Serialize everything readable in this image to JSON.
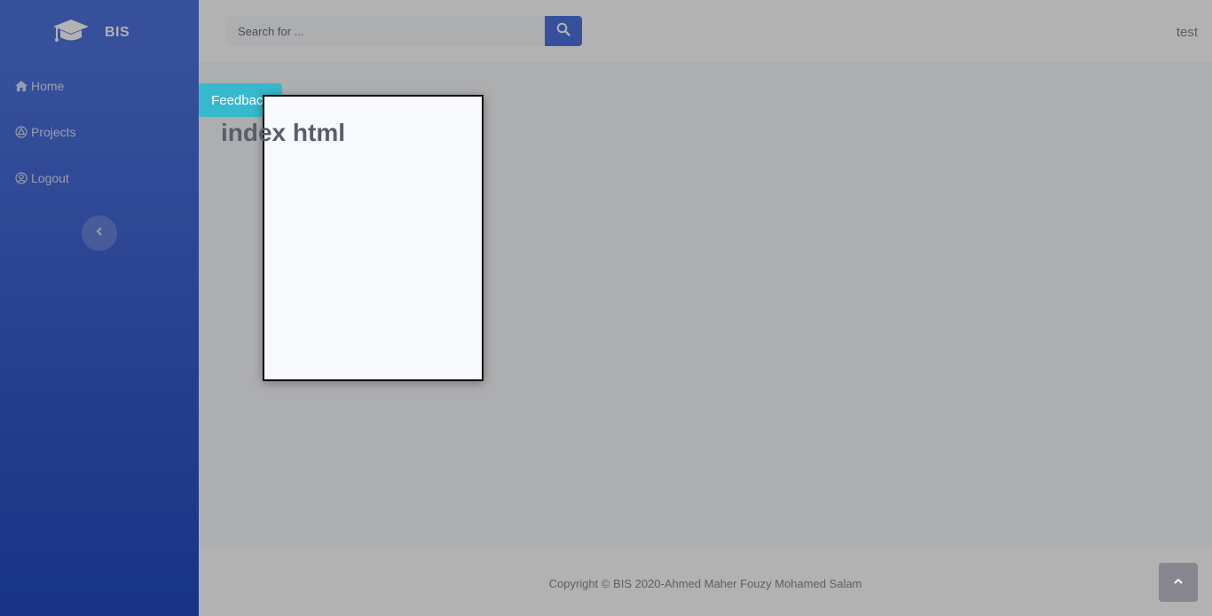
{
  "brand": {
    "name": "BIS",
    "icon": "graduation-cap-icon"
  },
  "sidebar": {
    "items": [
      {
        "label": "Home",
        "icon": "home-icon"
      },
      {
        "label": "Projects",
        "icon": "projects-icon"
      },
      {
        "label": "Logout",
        "icon": "user-circle-icon"
      }
    ],
    "toggle_icon": "chevron-left-icon"
  },
  "topbar": {
    "search_placeholder": "Search for ...",
    "search_icon": "search-icon",
    "user": "test"
  },
  "main": {
    "heading": "index html"
  },
  "feedback": {
    "label": "Feedback"
  },
  "footer": {
    "copyright": "Copyright © BIS 2020-Ahmed Maher Fouzy Mohamed Salam"
  },
  "colors": {
    "primary": "#4e73df",
    "primary_dark": "#224abe",
    "info": "#36b9cc",
    "overlay": "rgba(0,0,0,0.3)"
  }
}
